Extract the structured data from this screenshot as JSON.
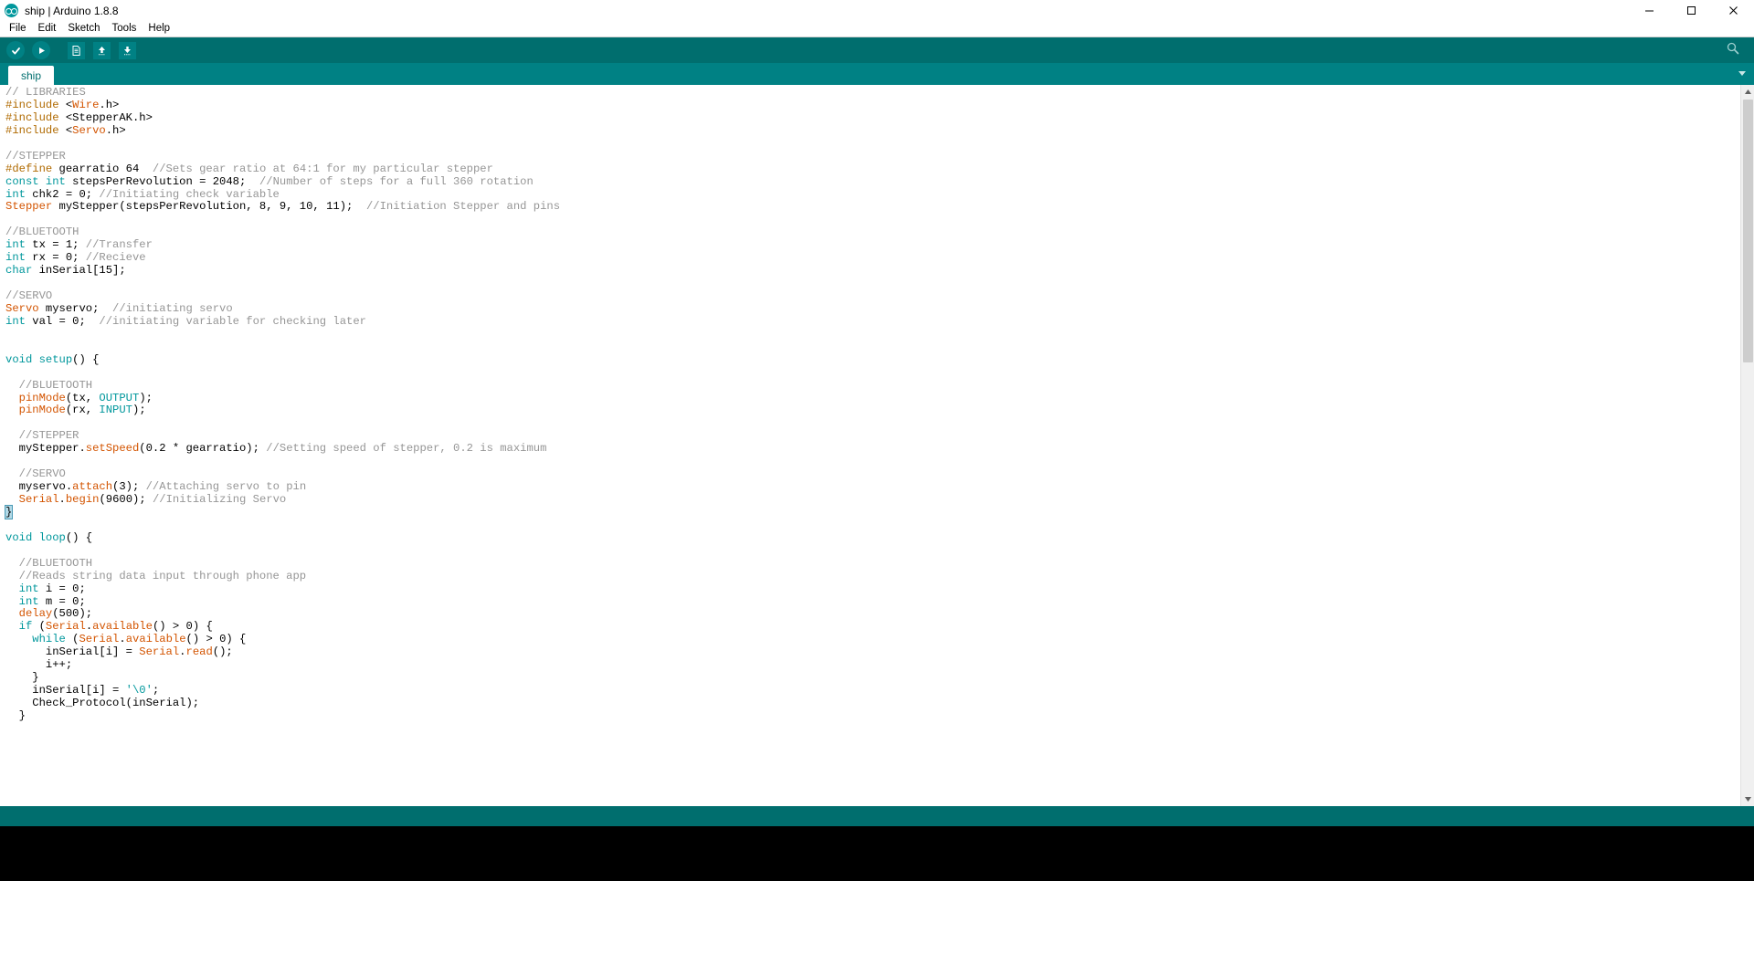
{
  "window": {
    "title": "ship | Arduino 1.8.8",
    "logo_icon": "arduino-infinity-logo",
    "minimize_icon": "minimize-icon",
    "maximize_icon": "maximize-icon",
    "close_icon": "close-icon"
  },
  "menubar": {
    "items": [
      {
        "label": "File"
      },
      {
        "label": "Edit"
      },
      {
        "label": "Sketch"
      },
      {
        "label": "Tools"
      },
      {
        "label": "Help"
      }
    ]
  },
  "toolbar": {
    "buttons": [
      {
        "name": "verify-button",
        "icon": "checkmark-icon",
        "tooltip": "Verify"
      },
      {
        "name": "upload-button",
        "icon": "arrow-right-icon",
        "tooltip": "Upload"
      },
      {
        "name": "new-button",
        "icon": "new-file-icon",
        "tooltip": "New"
      },
      {
        "name": "open-button",
        "icon": "arrow-up-icon",
        "tooltip": "Open"
      },
      {
        "name": "save-button",
        "icon": "arrow-down-icon",
        "tooltip": "Save"
      }
    ],
    "serial_monitor": {
      "name": "serial-monitor-button",
      "icon": "magnifier-icon",
      "tooltip": "Serial Monitor"
    }
  },
  "tabs": {
    "items": [
      {
        "label": "ship",
        "active": true
      }
    ],
    "menu_icon": "chevron-down-icon"
  },
  "editor": {
    "lines": [
      [
        {
          "t": "// LIBRARIES",
          "c": "cmt"
        }
      ],
      [
        {
          "t": "#include ",
          "c": "pp"
        },
        {
          "t": "<",
          "c": ""
        },
        {
          "t": "Wire",
          "c": "lib"
        },
        {
          "t": ".h>",
          "c": ""
        }
      ],
      [
        {
          "t": "#include ",
          "c": "pp"
        },
        {
          "t": "<StepperAK.h>",
          "c": ""
        }
      ],
      [
        {
          "t": "#include ",
          "c": "pp"
        },
        {
          "t": "<",
          "c": ""
        },
        {
          "t": "Servo",
          "c": "lib"
        },
        {
          "t": ".h>",
          "c": ""
        }
      ],
      [
        {
          "t": "",
          "c": ""
        }
      ],
      [
        {
          "t": "//STEPPER",
          "c": "cmt"
        }
      ],
      [
        {
          "t": "#define",
          "c": "pp"
        },
        {
          "t": " gearratio 64  ",
          "c": ""
        },
        {
          "t": "//Sets gear ratio at 64:1 for my particular stepper",
          "c": "cmt"
        }
      ],
      [
        {
          "t": "const int",
          "c": "kw"
        },
        {
          "t": " stepsPerRevolution = 2048;  ",
          "c": ""
        },
        {
          "t": "//Number of steps for a full 360 rotation",
          "c": "cmt"
        }
      ],
      [
        {
          "t": "int",
          "c": "kw"
        },
        {
          "t": " chk2 = 0; ",
          "c": ""
        },
        {
          "t": "//Initiating check variable",
          "c": "cmt"
        }
      ],
      [
        {
          "t": "Stepper",
          "c": "lib"
        },
        {
          "t": " myStepper(stepsPerRevolution, 8, 9, 10, 11);  ",
          "c": ""
        },
        {
          "t": "//Initiation Stepper and pins",
          "c": "cmt"
        }
      ],
      [
        {
          "t": "",
          "c": ""
        }
      ],
      [
        {
          "t": "//BLUETOOTH",
          "c": "cmt"
        }
      ],
      [
        {
          "t": "int",
          "c": "kw"
        },
        {
          "t": " tx = 1; ",
          "c": ""
        },
        {
          "t": "//Transfer",
          "c": "cmt"
        }
      ],
      [
        {
          "t": "int",
          "c": "kw"
        },
        {
          "t": " rx = 0; ",
          "c": ""
        },
        {
          "t": "//Recieve",
          "c": "cmt"
        }
      ],
      [
        {
          "t": "char",
          "c": "kw"
        },
        {
          "t": " inSerial[15];",
          "c": ""
        }
      ],
      [
        {
          "t": "",
          "c": ""
        }
      ],
      [
        {
          "t": "//SERVO",
          "c": "cmt"
        }
      ],
      [
        {
          "t": "Servo",
          "c": "lib"
        },
        {
          "t": " myservo;  ",
          "c": ""
        },
        {
          "t": "//initiating servo",
          "c": "cmt"
        }
      ],
      [
        {
          "t": "int",
          "c": "kw"
        },
        {
          "t": " val = 0;  ",
          "c": ""
        },
        {
          "t": "//initiating variable for checking later",
          "c": "cmt"
        }
      ],
      [
        {
          "t": "",
          "c": ""
        }
      ],
      [
        {
          "t": "",
          "c": ""
        }
      ],
      [
        {
          "t": "void",
          "c": "kw"
        },
        {
          "t": " ",
          "c": ""
        },
        {
          "t": "setup",
          "c": "kw"
        },
        {
          "t": "() {",
          "c": ""
        }
      ],
      [
        {
          "t": "",
          "c": ""
        }
      ],
      [
        {
          "t": "  //BLUETOOTH",
          "c": "cmt"
        }
      ],
      [
        {
          "t": "  ",
          "c": ""
        },
        {
          "t": "pinMode",
          "c": "fn"
        },
        {
          "t": "(tx, ",
          "c": ""
        },
        {
          "t": "OUTPUT",
          "c": "con"
        },
        {
          "t": ");",
          "c": ""
        }
      ],
      [
        {
          "t": "  ",
          "c": ""
        },
        {
          "t": "pinMode",
          "c": "fn"
        },
        {
          "t": "(rx, ",
          "c": ""
        },
        {
          "t": "INPUT",
          "c": "con"
        },
        {
          "t": ");",
          "c": ""
        }
      ],
      [
        {
          "t": "",
          "c": ""
        }
      ],
      [
        {
          "t": "  //STEPPER",
          "c": "cmt"
        }
      ],
      [
        {
          "t": "  myStepper.",
          "c": ""
        },
        {
          "t": "setSpeed",
          "c": "fn"
        },
        {
          "t": "(0.2 * gearratio); ",
          "c": ""
        },
        {
          "t": "//Setting speed of stepper, 0.2 is maximum",
          "c": "cmt"
        }
      ],
      [
        {
          "t": "",
          "c": ""
        }
      ],
      [
        {
          "t": "  //SERVO",
          "c": "cmt"
        }
      ],
      [
        {
          "t": "  myservo.",
          "c": ""
        },
        {
          "t": "attach",
          "c": "fn"
        },
        {
          "t": "(3); ",
          "c": ""
        },
        {
          "t": "//Attaching servo to pin",
          "c": "cmt"
        }
      ],
      [
        {
          "t": "  ",
          "c": ""
        },
        {
          "t": "Serial",
          "c": "lib"
        },
        {
          "t": ".",
          "c": ""
        },
        {
          "t": "begin",
          "c": "fn"
        },
        {
          "t": "(9600); ",
          "c": ""
        },
        {
          "t": "//Initializing Servo",
          "c": "cmt"
        }
      ],
      [
        {
          "t": "}",
          "c": "selbrace"
        }
      ],
      [
        {
          "t": "",
          "c": ""
        }
      ],
      [
        {
          "t": "void",
          "c": "kw"
        },
        {
          "t": " ",
          "c": ""
        },
        {
          "t": "loop",
          "c": "kw"
        },
        {
          "t": "() {",
          "c": ""
        }
      ],
      [
        {
          "t": "",
          "c": ""
        }
      ],
      [
        {
          "t": "  //BLUETOOTH",
          "c": "cmt"
        }
      ],
      [
        {
          "t": "  //Reads string data input through phone app",
          "c": "cmt"
        }
      ],
      [
        {
          "t": "  ",
          "c": ""
        },
        {
          "t": "int",
          "c": "kw"
        },
        {
          "t": " i = 0;",
          "c": ""
        }
      ],
      [
        {
          "t": "  ",
          "c": ""
        },
        {
          "t": "int",
          "c": "kw"
        },
        {
          "t": " m = 0;",
          "c": ""
        }
      ],
      [
        {
          "t": "  ",
          "c": ""
        },
        {
          "t": "delay",
          "c": "fn"
        },
        {
          "t": "(500);",
          "c": ""
        }
      ],
      [
        {
          "t": "  ",
          "c": ""
        },
        {
          "t": "if",
          "c": "kw"
        },
        {
          "t": " (",
          "c": ""
        },
        {
          "t": "Serial",
          "c": "lib"
        },
        {
          "t": ".",
          "c": ""
        },
        {
          "t": "available",
          "c": "fn"
        },
        {
          "t": "() > 0) {",
          "c": ""
        }
      ],
      [
        {
          "t": "    ",
          "c": ""
        },
        {
          "t": "while",
          "c": "kw"
        },
        {
          "t": " (",
          "c": ""
        },
        {
          "t": "Serial",
          "c": "lib"
        },
        {
          "t": ".",
          "c": ""
        },
        {
          "t": "available",
          "c": "fn"
        },
        {
          "t": "() > 0) {",
          "c": ""
        }
      ],
      [
        {
          "t": "      inSerial[i] = ",
          "c": ""
        },
        {
          "t": "Serial",
          "c": "lib"
        },
        {
          "t": ".",
          "c": ""
        },
        {
          "t": "read",
          "c": "fn"
        },
        {
          "t": "();",
          "c": ""
        }
      ],
      [
        {
          "t": "      i++;",
          "c": ""
        }
      ],
      [
        {
          "t": "    }",
          "c": ""
        }
      ],
      [
        {
          "t": "    inSerial[i] = ",
          "c": ""
        },
        {
          "t": "'\\0'",
          "c": "str"
        },
        {
          "t": ";",
          "c": ""
        }
      ],
      [
        {
          "t": "    Check_Protocol(inSerial);",
          "c": ""
        }
      ],
      [
        {
          "t": "  }",
          "c": ""
        }
      ]
    ],
    "scrollbar": {
      "up_icon": "scroll-up-arrow-icon",
      "down_icon": "scroll-down-arrow-icon"
    }
  },
  "status": {
    "message": "",
    "console_text": ""
  },
  "colors": {
    "toolbar_bg": "#006e6e",
    "tabbar_bg": "#008184",
    "tab_active_bg": "#ffffff",
    "tab_active_text": "#006e6e",
    "keyword": "#00979c",
    "library": "#d35400",
    "comment": "#969696",
    "preprocessor": "#b06a00",
    "console_bg": "#000000"
  }
}
